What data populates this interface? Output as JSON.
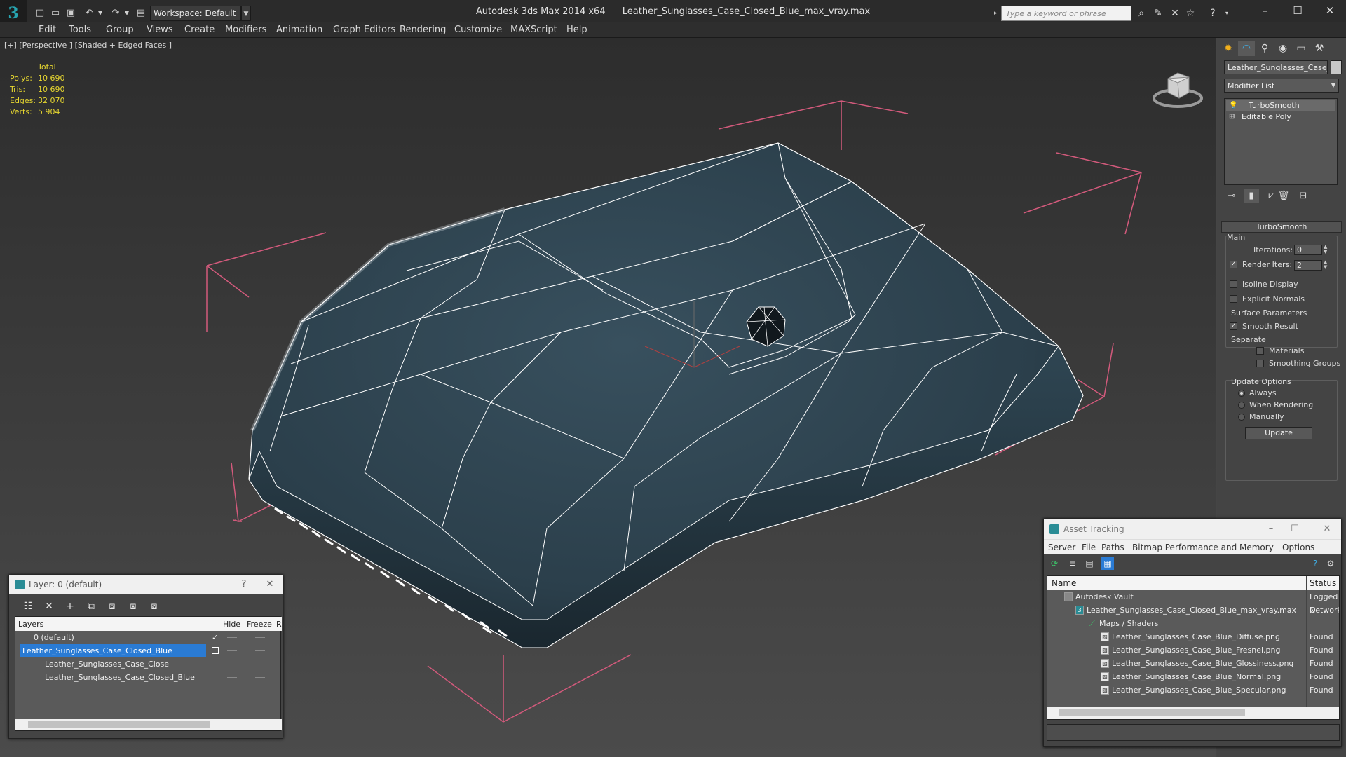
{
  "titlebar": {
    "app": "Autodesk 3ds Max  2014 x64",
    "file": "Leather_Sunglasses_Case_Closed_Blue_max_vray.max",
    "workspace": "Workspace: Default",
    "search_placeholder": "Type a keyword or phrase"
  },
  "menu": [
    "Edit",
    "Tools",
    "Group",
    "Views",
    "Create",
    "Modifiers",
    "Animation",
    "Graph Editors",
    "Rendering",
    "Customize",
    "MAXScript",
    "Help"
  ],
  "viewport": {
    "label": "[+] [Perspective ] [Shaded + Edged Faces ]",
    "stats": {
      "header": "Total",
      "rows": [
        {
          "k": "Polys:",
          "v": "10 690"
        },
        {
          "k": "Tris:",
          "v": "10 690"
        },
        {
          "k": "Edges:",
          "v": "32 070"
        },
        {
          "k": "Verts:",
          "v": "5 904"
        }
      ]
    }
  },
  "command_panel": {
    "object_name": "Leather_Sunglasses_Case_Cl",
    "modifier_list": "Modifier List",
    "stack": [
      "TurboSmooth",
      "Editable Poly"
    ],
    "rollout": "TurboSmooth",
    "main_label": "Main",
    "iterations_label": "Iterations:",
    "iterations_value": "0",
    "render_iters_label": "Render Iters:",
    "render_iters_value": "2",
    "isoline": "Isoline Display",
    "explicit_normals": "Explicit Normals",
    "surface_params": "Surface Parameters",
    "smooth_result": "Smooth Result",
    "separate": "Separate",
    "materials": "Materials",
    "smoothing_groups": "Smoothing Groups",
    "update_options": "Update Options",
    "always": "Always",
    "when_rendering": "When Rendering",
    "manually": "Manually",
    "update_button": "Update"
  },
  "layer_dialog": {
    "title": "Layer: 0 (default)",
    "help": "?",
    "columns": {
      "layers": "Layers",
      "hide": "Hide",
      "freeze": "Freeze",
      "r": "R"
    },
    "rows": [
      {
        "name": "0 (default)"
      },
      {
        "name": "Leather_Sunglasses_Case_Closed_Blue"
      },
      {
        "name": "Leather_Sunglasses_Case_Close"
      },
      {
        "name": "Leather_Sunglasses_Case_Closed_Blue"
      }
    ]
  },
  "asset_dialog": {
    "title": "Asset Tracking",
    "menu": [
      "Server",
      "File",
      "Paths",
      "Bitmap Performance and Memory",
      "Options"
    ],
    "columns": {
      "name": "Name",
      "status": "Status"
    },
    "rows": [
      {
        "name": "Autodesk Vault",
        "status": "Logged O"
      },
      {
        "name": "Leather_Sunglasses_Case_Closed_Blue_max_vray.max",
        "status": "Network"
      },
      {
        "name": "Maps / Shaders",
        "status": ""
      },
      {
        "name": "Leather_Sunglasses_Case_Blue_Diffuse.png",
        "status": "Found"
      },
      {
        "name": "Leather_Sunglasses_Case_Blue_Fresnel.png",
        "status": "Found"
      },
      {
        "name": "Leather_Sunglasses_Case_Blue_Glossiness.png",
        "status": "Found"
      },
      {
        "name": "Leather_Sunglasses_Case_Blue_Normal.png",
        "status": "Found"
      },
      {
        "name": "Leather_Sunglasses_Case_Blue_Specular.png",
        "status": "Found"
      }
    ]
  },
  "colors": {
    "accent": "#2a7bd4",
    "stats": "#e6d630",
    "mesh": "#2e4452"
  }
}
